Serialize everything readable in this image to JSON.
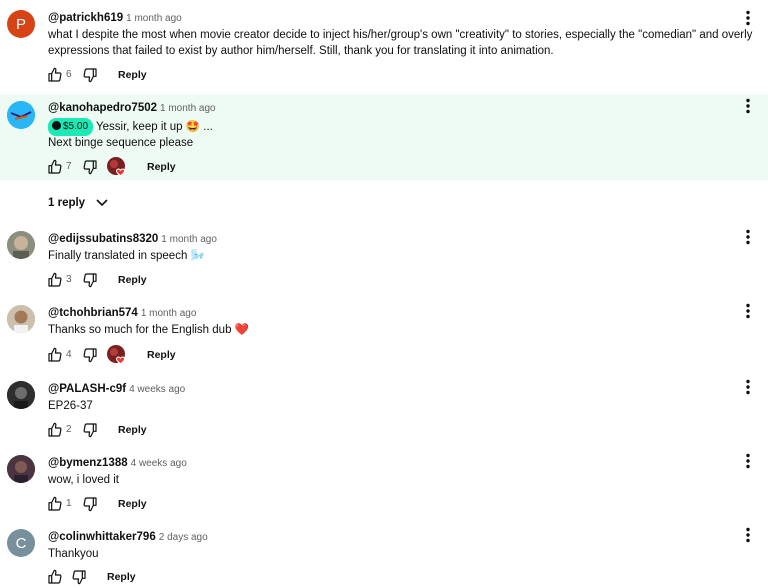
{
  "comments": [
    {
      "author": "@patrickh619",
      "time": "1 month ago",
      "avatar_letter": "P",
      "avatar_color": "#d84315",
      "text_line1": "what I despite the most when movie creator decide to inject his/her/group's own \"creativity\" to stories, especially the \"comedian\" and overly",
      "text_line2": "expressions that failed to exist by author him/herself.  Still, thank you for translating it into animation.",
      "likes": "6",
      "reply_label": "Reply"
    },
    {
      "author": "@kanohapedro7502",
      "time": "1 month ago",
      "super_thanks": "$5.00",
      "super_text": "Yessir, keep it up 🤩 ...",
      "text": "Next binge sequence please",
      "likes": "7",
      "creator_heart": true,
      "reply_label": "Reply",
      "replies_label": "1 reply"
    },
    {
      "author": "@edijssubatins8320",
      "time": "1 month ago",
      "text": "Finally translated in speech 🌬️",
      "likes": "3",
      "reply_label": "Reply"
    },
    {
      "author": "@tchohbrian574",
      "time": "1 month ago",
      "text": "Thanks so much for the English dub ❤️",
      "likes": "4",
      "creator_heart": true,
      "reply_label": "Reply"
    },
    {
      "author": "@PALASH-c9f",
      "time": "4 weeks ago",
      "text": "EP26-37",
      "likes": "2",
      "reply_label": "Reply"
    },
    {
      "author": "@bymenz1388",
      "time": "4 weeks ago",
      "text": "wow, i loved it",
      "likes": "1",
      "reply_label": "Reply"
    },
    {
      "author": "@colinwhittaker796",
      "time": "2 days ago",
      "avatar_letter": "C",
      "avatar_color": "#78909c",
      "text": "Thankyou",
      "reply_label": "Reply"
    }
  ],
  "colors": {
    "highlight_bg": "#eefbf4",
    "super_thanks": "#1de9b6",
    "heart": "#e53935"
  }
}
